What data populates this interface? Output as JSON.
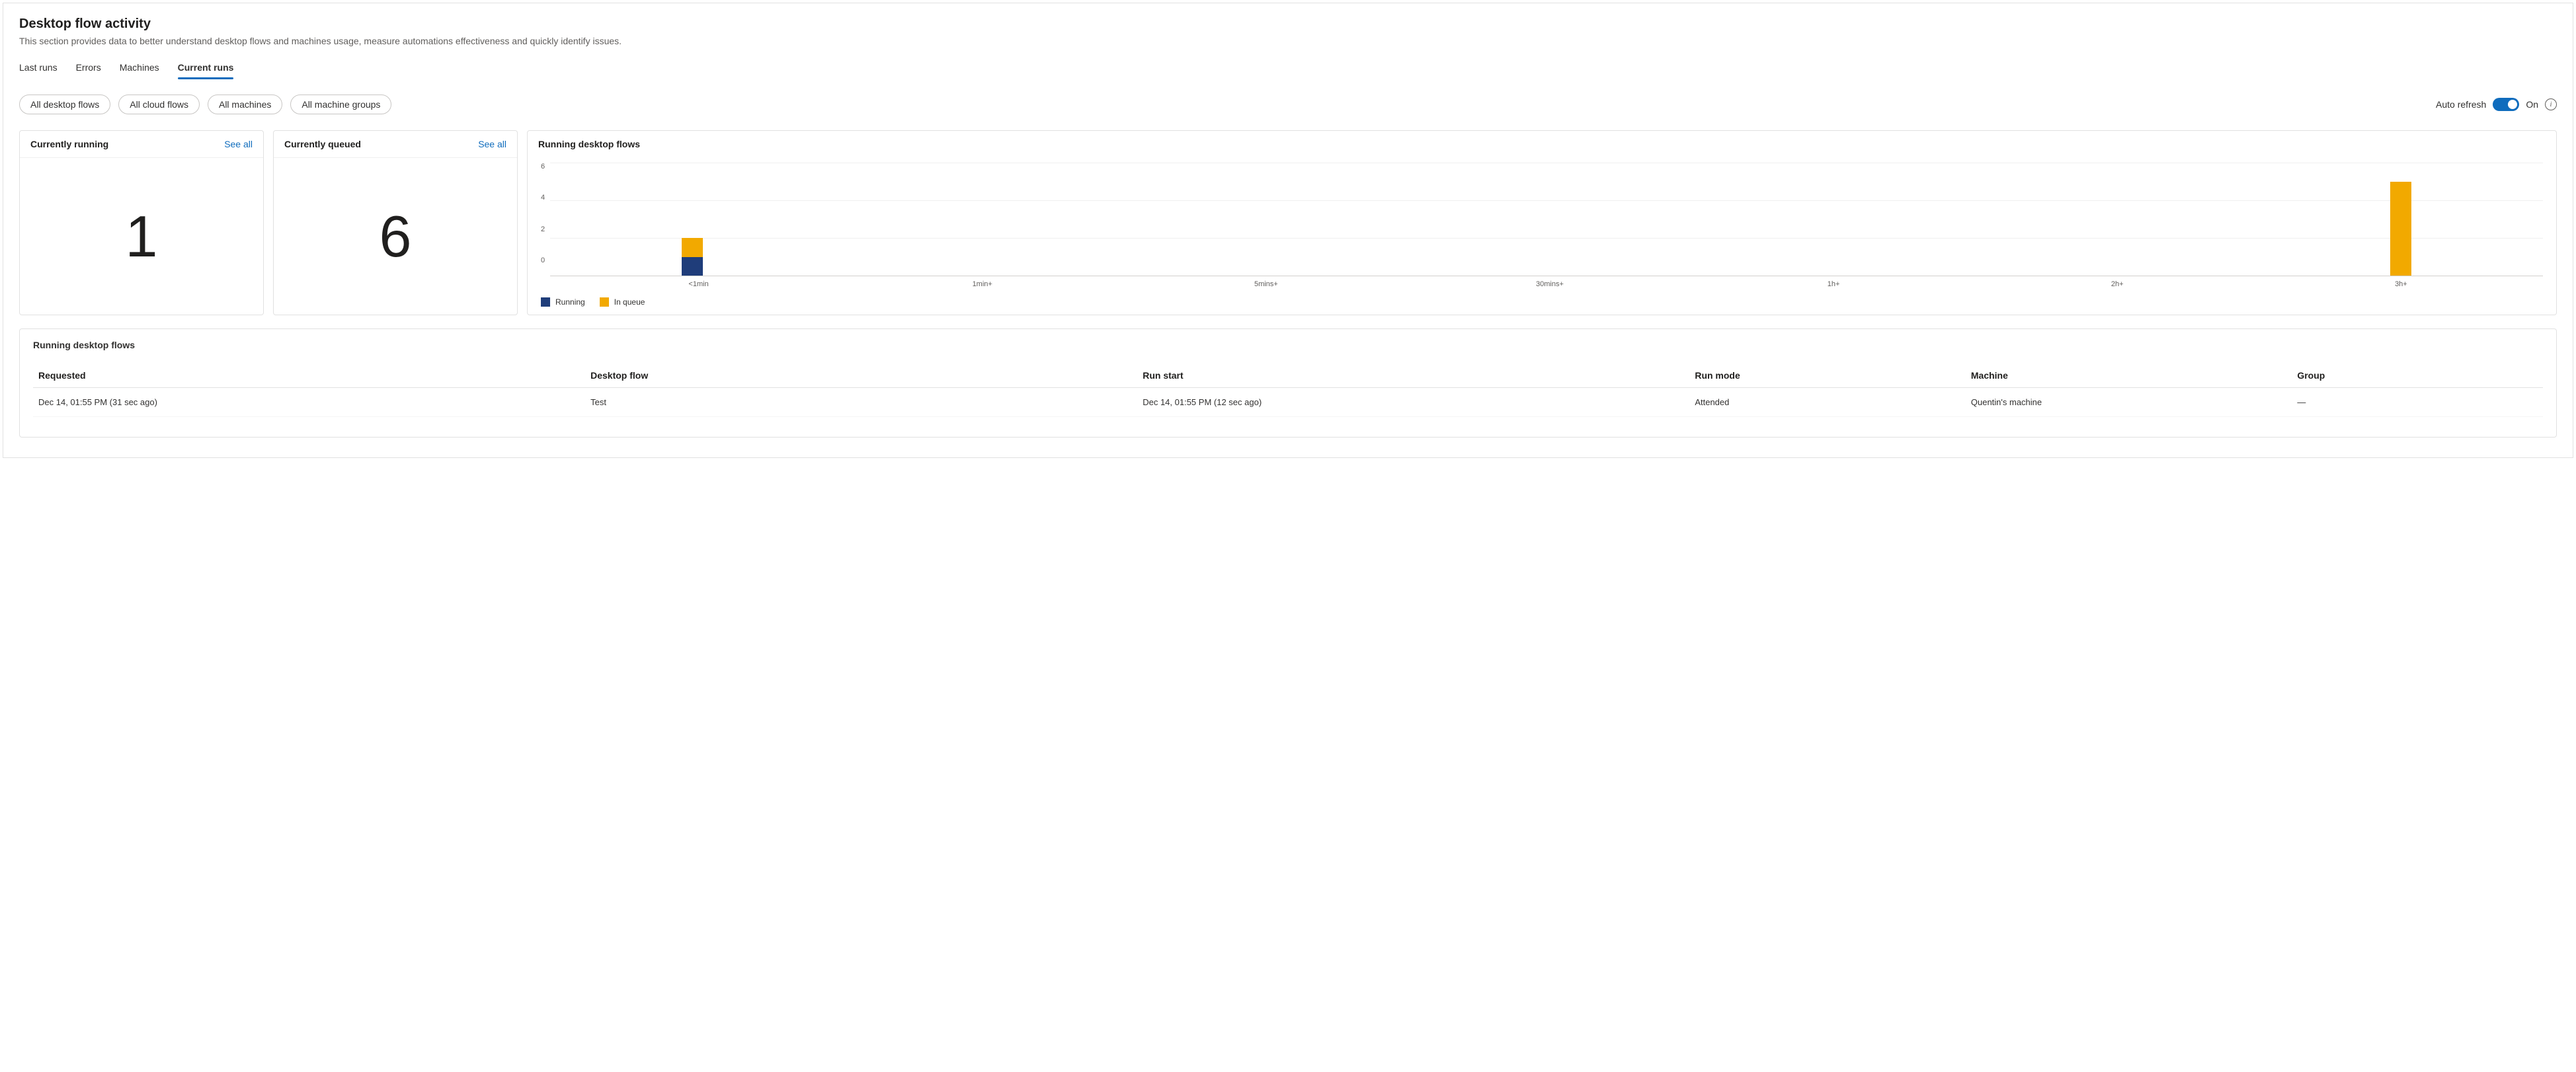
{
  "header": {
    "title": "Desktop flow activity",
    "subtitle": "This section provides data to better understand desktop flows and machines usage, measure automations effectiveness and quickly identify issues."
  },
  "tabs": [
    {
      "label": "Last runs",
      "active": false
    },
    {
      "label": "Errors",
      "active": false
    },
    {
      "label": "Machines",
      "active": false
    },
    {
      "label": "Current runs",
      "active": true
    }
  ],
  "filters": [
    {
      "label": "All desktop flows"
    },
    {
      "label": "All cloud flows"
    },
    {
      "label": "All machines"
    },
    {
      "label": "All machine groups"
    }
  ],
  "auto_refresh": {
    "label": "Auto refresh",
    "state_label": "On",
    "on": true
  },
  "cards": {
    "running": {
      "title": "Currently running",
      "see_all": "See all",
      "value": "1"
    },
    "queued": {
      "title": "Currently queued",
      "see_all": "See all",
      "value": "6"
    },
    "chart": {
      "title": "Running desktop flows",
      "legend": {
        "running": "Running",
        "queue": "In queue"
      }
    }
  },
  "chart_data": {
    "type": "bar",
    "categories": [
      "<1min",
      "1min+",
      "5mins+",
      "30mins+",
      "1h+",
      "2h+",
      "3h+"
    ],
    "series": [
      {
        "name": "Running",
        "values": [
          1,
          0,
          0,
          0,
          0,
          0,
          0
        ],
        "color": "#1f3d7a"
      },
      {
        "name": "In queue",
        "values": [
          1,
          0,
          0,
          0,
          0,
          0,
          5
        ],
        "color": "#f2a900"
      }
    ],
    "ylim": [
      0,
      6
    ],
    "yticks": [
      0,
      2,
      4,
      6
    ],
    "xlabel": "",
    "ylabel": ""
  },
  "table": {
    "title": "Running desktop flows",
    "columns": [
      "Requested",
      "Desktop flow",
      "Run start",
      "Run mode",
      "Machine",
      "Group"
    ],
    "rows": [
      {
        "requested": "Dec 14, 01:55 PM (31 sec ago)",
        "flow": "Test",
        "start": "Dec 14, 01:55 PM (12 sec ago)",
        "mode": "Attended",
        "machine": "Quentin's machine",
        "group": "—"
      }
    ]
  }
}
